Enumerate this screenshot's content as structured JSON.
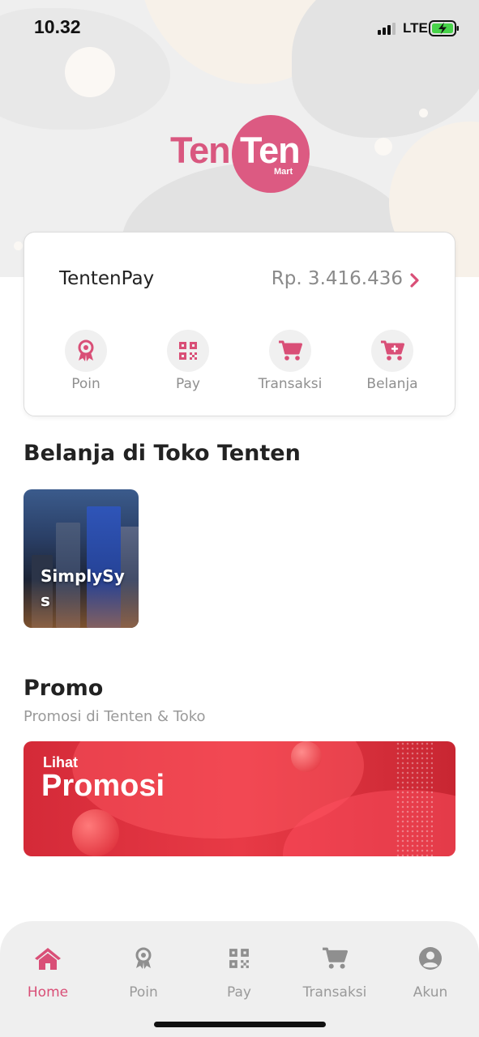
{
  "status_bar": {
    "time": "10.32",
    "network": "LTE"
  },
  "logo": {
    "word1": "Ten",
    "word2": "Ten",
    "sub": "Mart"
  },
  "wallet": {
    "name": "TentenPay",
    "balance": "Rp. 3.416.436",
    "actions": [
      {
        "label": "Poin",
        "icon": "award-icon"
      },
      {
        "label": "Pay",
        "icon": "qr-code-icon"
      },
      {
        "label": "Transaksi",
        "icon": "cart-icon"
      },
      {
        "label": "Belanja",
        "icon": "cart-plus-icon"
      }
    ]
  },
  "stores": {
    "title": "Belanja di Toko Tenten",
    "items": [
      {
        "name": "SimplySys"
      }
    ]
  },
  "promo": {
    "title": "Promo",
    "subtitle": "Promosi di Tenten & Toko",
    "banner_small": "Lihat",
    "banner_big": "Promosi"
  },
  "bottom_nav": {
    "items": [
      {
        "label": "Home",
        "icon": "home-icon",
        "active": true
      },
      {
        "label": "Poin",
        "icon": "award-icon",
        "active": false
      },
      {
        "label": "Pay",
        "icon": "qr-code-icon",
        "active": false
      },
      {
        "label": "Transaksi",
        "icon": "cart-icon",
        "active": false
      },
      {
        "label": "Akun",
        "icon": "user-circle-icon",
        "active": false
      }
    ]
  },
  "colors": {
    "accent": "#d94f77",
    "muted": "#9a9a9a",
    "promo_red": "#e83a46"
  }
}
